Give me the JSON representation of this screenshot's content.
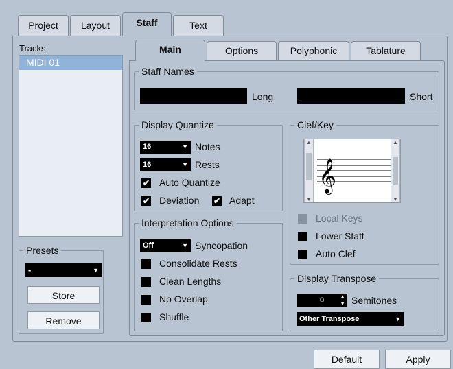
{
  "tabs": [
    {
      "label": "Project",
      "active": false
    },
    {
      "label": "Layout",
      "active": false
    },
    {
      "label": "Staff",
      "active": true
    },
    {
      "label": "Text",
      "active": false
    }
  ],
  "tracks": {
    "label": "Tracks",
    "items": [
      "MIDI 01"
    ]
  },
  "presets": {
    "label": "Presets",
    "value": "-",
    "store_label": "Store",
    "remove_label": "Remove"
  },
  "subtabs": [
    {
      "label": "Main",
      "active": true
    },
    {
      "label": "Options",
      "active": false
    },
    {
      "label": "Polyphonic",
      "active": false
    },
    {
      "label": "Tablature",
      "active": false
    }
  ],
  "staff_names": {
    "title": "Staff Names",
    "long_label": "Long",
    "short_label": "Short",
    "long_value": "",
    "short_value": ""
  },
  "display_quantize": {
    "title": "Display Quantize",
    "notes_value": "16",
    "notes_label": "Notes",
    "rests_value": "16",
    "rests_label": "Rests",
    "auto_quantize": {
      "label": "Auto Quantize",
      "checked": true
    },
    "deviation": {
      "label": "Deviation",
      "checked": true
    },
    "adapt": {
      "label": "Adapt",
      "checked": true
    }
  },
  "interpretation": {
    "title": "Interpretation Options",
    "syncopation_value": "Off",
    "syncopation_label": "Syncopation",
    "consolidate_rests": {
      "label": "Consolidate Rests",
      "checked": false
    },
    "clean_lengths": {
      "label": "Clean Lengths",
      "checked": false
    },
    "no_overlap": {
      "label": "No Overlap",
      "checked": false
    },
    "shuffle": {
      "label": "Shuffle",
      "checked": false
    }
  },
  "clef_key": {
    "title": "Clef/Key",
    "local_keys": {
      "label": "Local Keys",
      "checked": false,
      "disabled": true
    },
    "lower_staff": {
      "label": "Lower Staff",
      "checked": false
    },
    "auto_clef": {
      "label": "Auto Clef",
      "checked": false
    }
  },
  "display_transpose": {
    "title": "Display Transpose",
    "semitones_value": "0",
    "semitones_label": "Semitones",
    "other_value": "Other Transpose"
  },
  "footer": {
    "default_label": "Default",
    "apply_label": "Apply"
  },
  "colors": {
    "background": "#b9c4d2",
    "selection": "#8fb3d9",
    "field": "#000000"
  }
}
